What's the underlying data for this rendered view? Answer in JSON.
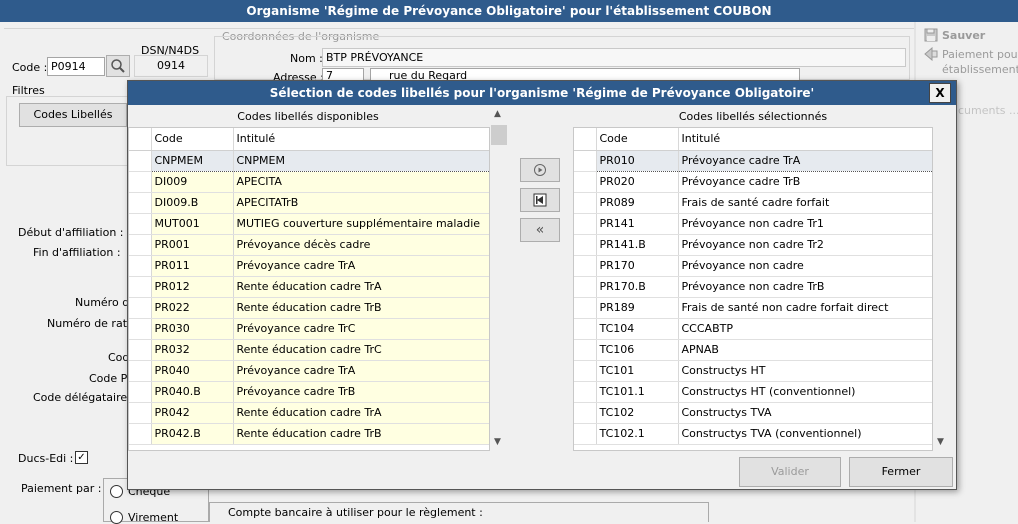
{
  "window": {
    "title": "Organisme 'Régime de Prévoyance Obligatoire' pour l'établissement COUBON"
  },
  "background": {
    "code_label": "Code :",
    "code_value": "P0914",
    "dsn_label": "DSN/N4DS",
    "dsn_value": "0914",
    "filtres_label": "Filtres",
    "codes_libelles_button": "Codes Libellés",
    "coordonnees_label": "Coordonnées de l'organisme",
    "nom_label": "Nom :",
    "nom_value": "BTP PRÉVOYANCE",
    "adresse_label": "Adresse :",
    "adresse_num": "7",
    "adresse_rue": "rue du Regard",
    "debut_label": "Début d'affiliation :",
    "fin_label": "Fin d'affiliation :",
    "numero_label": "Numéro d'a",
    "numero_ratt_label": "Numéro de ratta",
    "code_label2": "Cod",
    "code_postal_label": "Code Po",
    "code_delegataire_label": "Code délégataire de",
    "ducs_label": "Ducs-Edi :",
    "paiement_label": "Paiement par :",
    "cheque_label": "Chèque",
    "virement_label": "Virement",
    "compte_label": "Compte bancaire à utiliser pour le règlement :",
    "sauver_label": "Sauver",
    "paiement_etab_line1": "Paiement pour",
    "paiement_etab_line2": "établissement",
    "documents_label": "cuments ..."
  },
  "dialog": {
    "title": "Sélection de codes libellés pour l'organisme 'Régime de Prévoyance Obligatoire'",
    "close_label": "X",
    "left_caption": "Codes libellés disponibles",
    "right_caption": "Codes libellés sélectionnés",
    "col_code": "Code",
    "col_intitule": "Intitulé",
    "valider_label": "Valider",
    "fermer_label": "Fermer",
    "available": [
      {
        "code": "CNPMEM",
        "label": "CNPMEM"
      },
      {
        "code": "DI009",
        "label": "APECITA"
      },
      {
        "code": "DI009.B",
        "label": "APECITATrB"
      },
      {
        "code": "MUT001",
        "label": "MUTIEG couverture supplémentaire maladie"
      },
      {
        "code": "PR001",
        "label": "Prévoyance décès cadre"
      },
      {
        "code": "PR011",
        "label": "Prévoyance cadre TrA"
      },
      {
        "code": "PR012",
        "label": "Rente éducation cadre TrA"
      },
      {
        "code": "PR022",
        "label": "Rente éducation cadre TrB"
      },
      {
        "code": "PR030",
        "label": "Prévoyance cadre TrC"
      },
      {
        "code": "PR032",
        "label": "Rente éducation cadre TrC"
      },
      {
        "code": "PR040",
        "label": "Prévoyance cadre TrA"
      },
      {
        "code": "PR040.B",
        "label": "Prévoyance cadre TrB"
      },
      {
        "code": "PR042",
        "label": "Rente éducation cadre TrA"
      },
      {
        "code": "PR042.B",
        "label": "Rente éducation cadre TrB"
      }
    ],
    "selected": [
      {
        "code": "PR010",
        "label": "Prévoyance cadre TrA"
      },
      {
        "code": "PR020",
        "label": "Prévoyance cadre TrB"
      },
      {
        "code": "PR089",
        "label": "Frais de santé cadre forfait"
      },
      {
        "code": "PR141",
        "label": "Prévoyance non cadre Tr1"
      },
      {
        "code": "PR141.B",
        "label": "Prévoyance non cadre Tr2"
      },
      {
        "code": "PR170",
        "label": "Prévoyance non cadre"
      },
      {
        "code": "PR170.B",
        "label": "Prévoyance non cadre TrB"
      },
      {
        "code": "PR189",
        "label": "Frais de santé non cadre forfait direct"
      },
      {
        "code": "TC104",
        "label": "CCCABTP"
      },
      {
        "code": "TC106",
        "label": "APNAB"
      },
      {
        "code": "TC101",
        "label": "Constructys HT"
      },
      {
        "code": "TC101.1",
        "label": "Constructys HT (conventionnel)"
      },
      {
        "code": "TC102",
        "label": "Constructys TVA"
      },
      {
        "code": "TC102.1",
        "label": "Constructys TVA (conventionnel)"
      }
    ]
  }
}
